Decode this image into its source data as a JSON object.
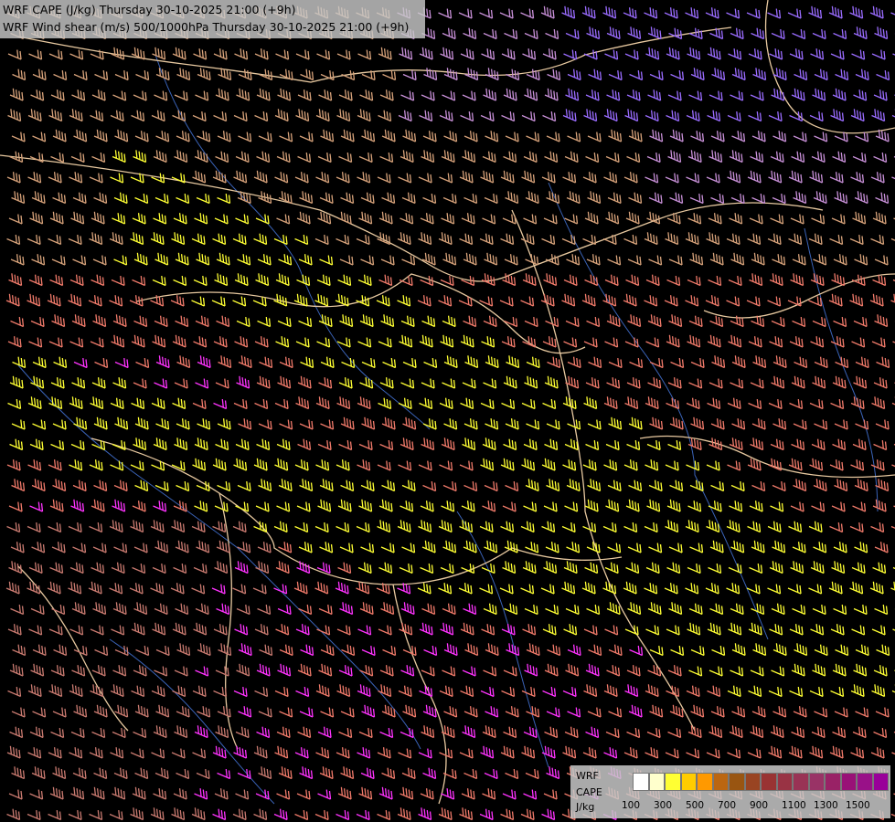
{
  "header": {
    "title_line1": "WRF CAPE (J/kg) Thursday 30-10-2025 21:00 (+9h)",
    "title_line2": "WRF Wind shear (m/s) 500/1000hPa Thursday 30-10-2025 21:00 (+9h)"
  },
  "map": {
    "background": "#000000",
    "border_color": "#e8c9a0",
    "river_color": "#3a63b8",
    "barb_palette": {
      "violet": "#9a6cff",
      "lilac": "#c890d8",
      "tan": "#d7a27a",
      "yellow": "#ffff33",
      "salmon": "#f07a6a",
      "rose": "#c97a70",
      "magenta": "#ff33ff"
    }
  },
  "legend": {
    "line1": "WRF",
    "line2": "CAPE",
    "line3": "J/kg",
    "colors": [
      "#ffffff",
      "#ffffcc",
      "#ffff33",
      "#ffcc00",
      "#ff9900",
      "#bb6611",
      "#995511",
      "#994422",
      "#993333",
      "#993344",
      "#993355",
      "#993366",
      "#992266",
      "#991177",
      "#991188",
      "#990099"
    ],
    "labels": [
      "100",
      "300",
      "500",
      "700",
      "900",
      "1100",
      "1300",
      "1500"
    ]
  }
}
